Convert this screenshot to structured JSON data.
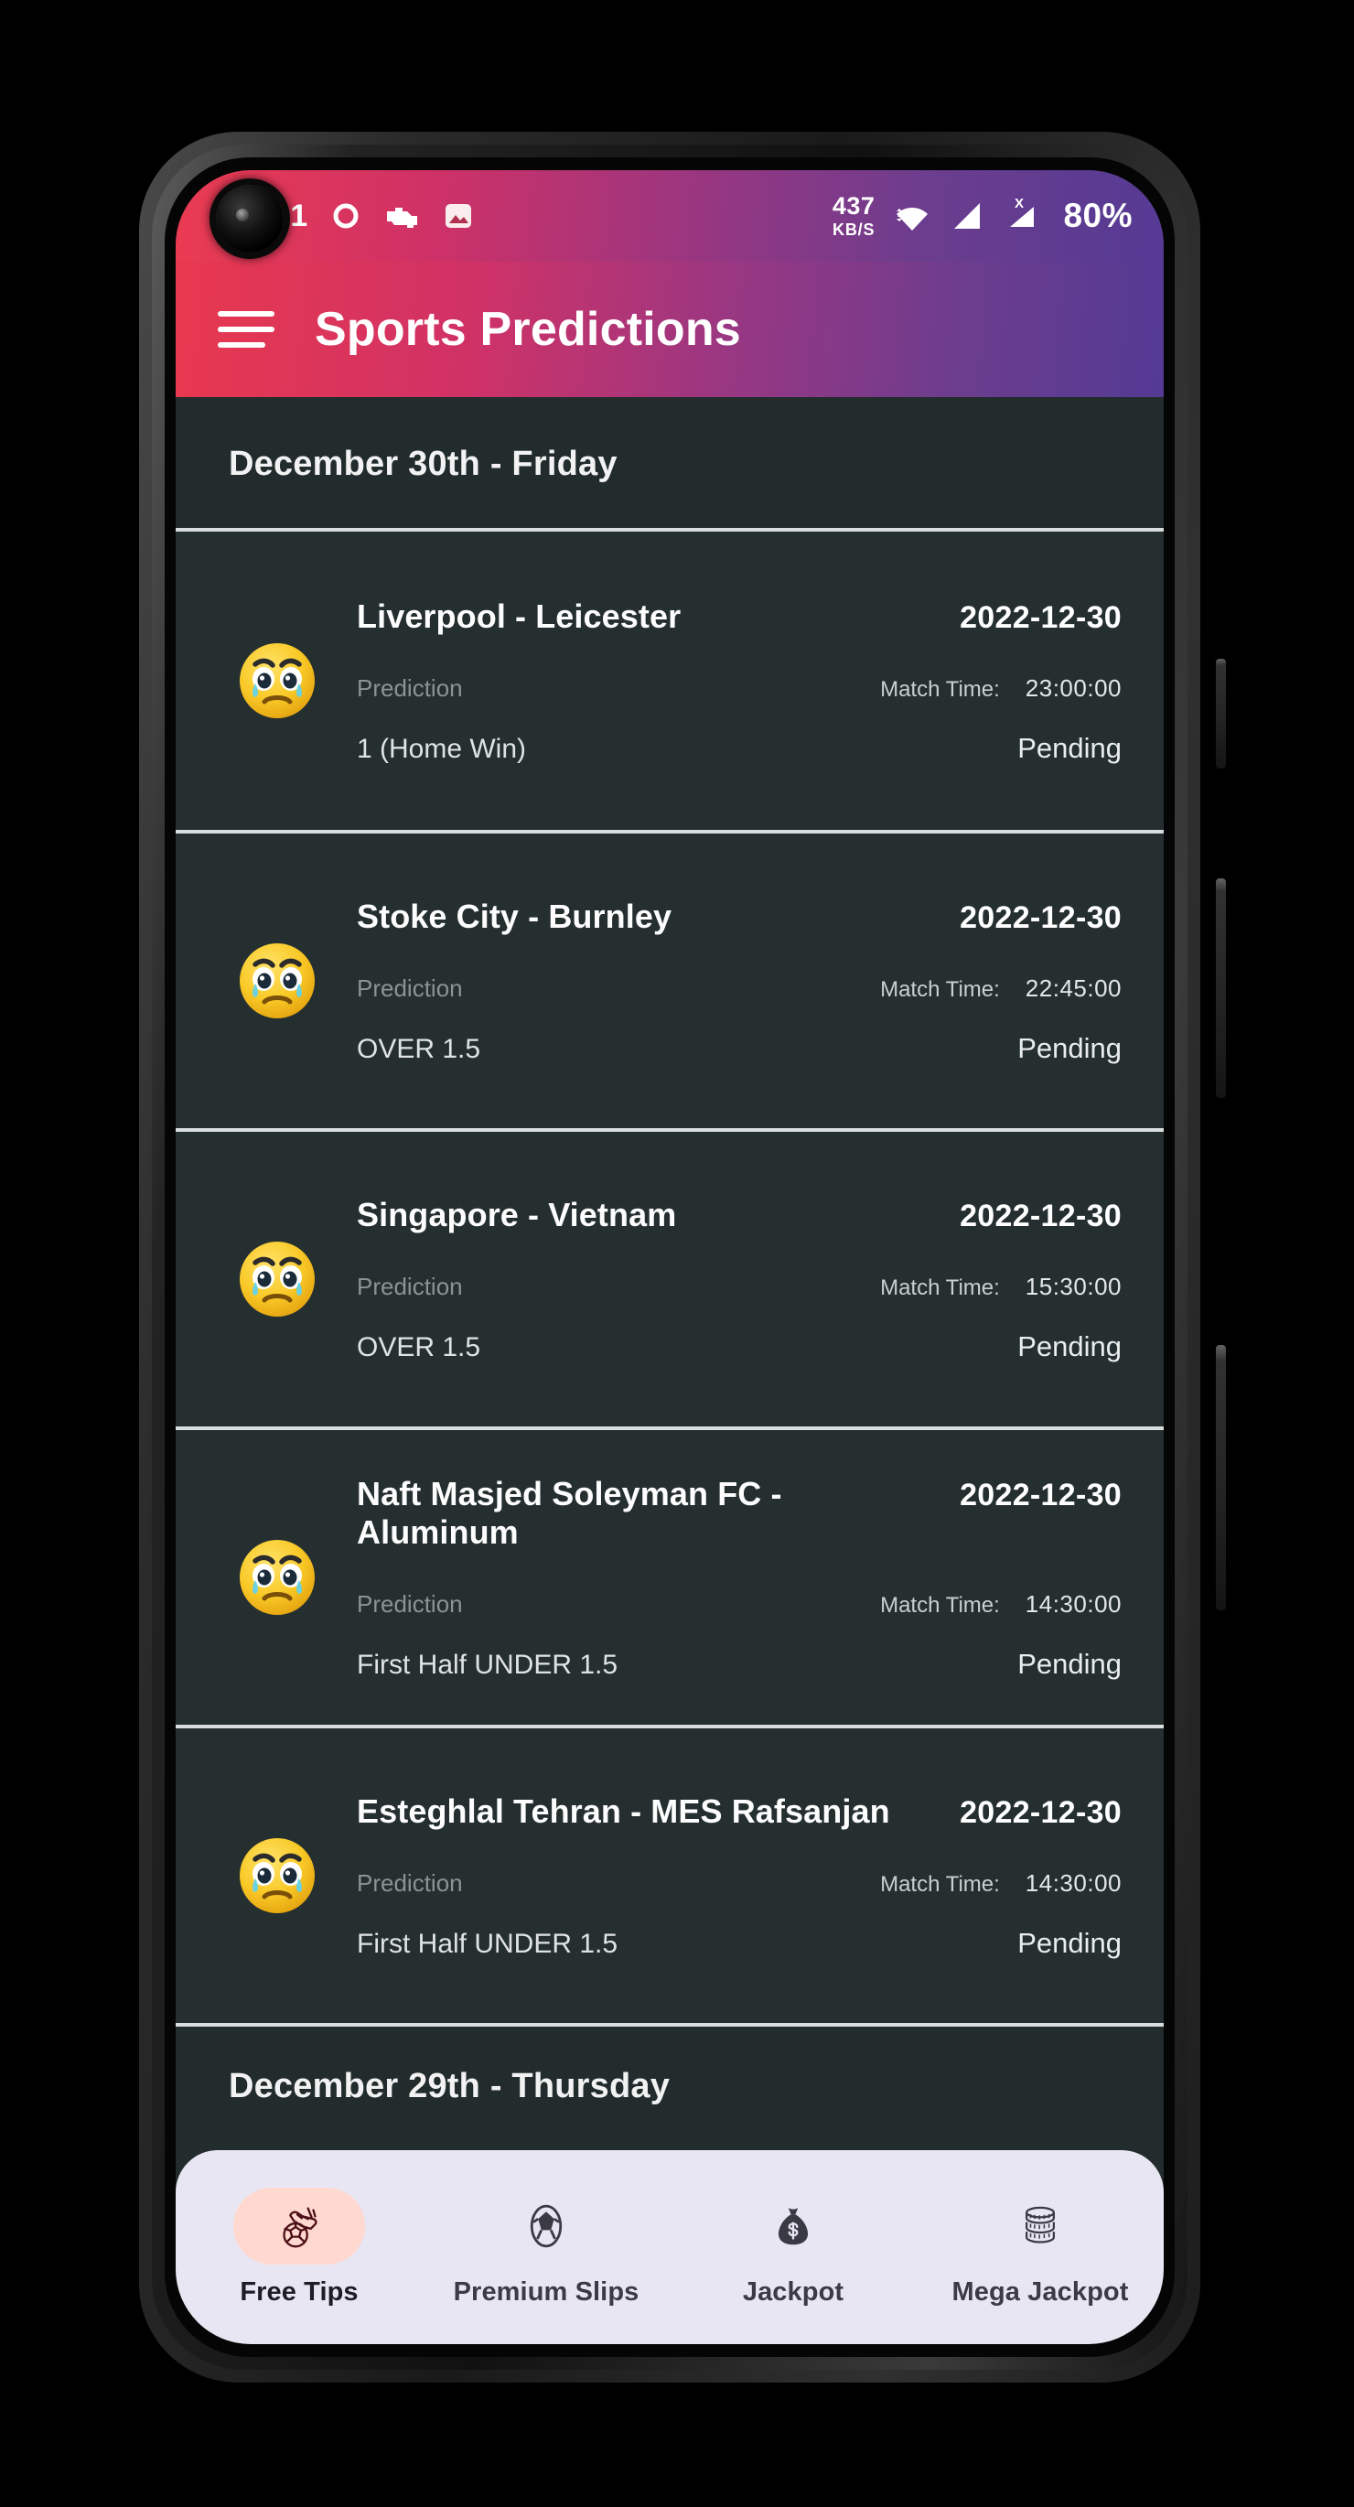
{
  "status_bar": {
    "time": ":41",
    "left_icons": [
      "circle-icon",
      "car-engine-icon",
      "image-icon"
    ],
    "network_speed_value": "437",
    "network_speed_unit": "KB/S",
    "wifi_icon": "wifi-icon",
    "signal_icon": "signal-bars-icon",
    "signal_x_icon": "signal-bars-no-service-icon",
    "battery": "80%"
  },
  "app_bar": {
    "menu_icon": "hamburger-menu-icon",
    "title": "Sports Predictions",
    "gradient_start": "#e8384f",
    "gradient_end": "#543a94"
  },
  "content": {
    "date_header": "December 30th - Friday",
    "next_date_header": "December 29th - Thursday",
    "prediction_label": "Prediction",
    "match_time_label": "Match Time:",
    "matches": [
      {
        "icon": "crying-face-emoji",
        "teams": "Liverpool - Leicester",
        "date": "2022-12-30",
        "time": "23:00:00",
        "prediction": "1 (Home Win)",
        "status": "Pending"
      },
      {
        "icon": "crying-face-emoji",
        "teams": "Stoke City - Burnley",
        "date": "2022-12-30",
        "time": "22:45:00",
        "prediction": "OVER 1.5",
        "status": "Pending"
      },
      {
        "icon": "crying-face-emoji",
        "teams": "Singapore - Vietnam",
        "date": "2022-12-30",
        "time": "15:30:00",
        "prediction": "OVER 1.5",
        "status": "Pending"
      },
      {
        "icon": "crying-face-emoji",
        "teams": "Naft Masjed Soleyman FC - Aluminum",
        "date": "2022-12-30",
        "time": "14:30:00",
        "prediction": "First Half UNDER 1.5",
        "status": "Pending"
      },
      {
        "icon": "crying-face-emoji",
        "teams": "Esteghlal Tehran - MES Rafsanjan",
        "date": "2022-12-30",
        "time": "14:30:00",
        "prediction": "First Half UNDER 1.5",
        "status": "Pending"
      }
    ]
  },
  "bottom_nav": {
    "active_index": 0,
    "active_pill_color": "#ffd8cf",
    "background_color": "#e9e6f3",
    "items": [
      {
        "icon": "soccer-boot-and-ball-icon",
        "label": "Free Tips"
      },
      {
        "icon": "soccer-ball-icon",
        "label": "Premium Slips"
      },
      {
        "icon": "money-bag-icon",
        "label": "Jackpot"
      },
      {
        "icon": "coins-stack-icon",
        "label": "Mega Jackpot"
      }
    ]
  }
}
